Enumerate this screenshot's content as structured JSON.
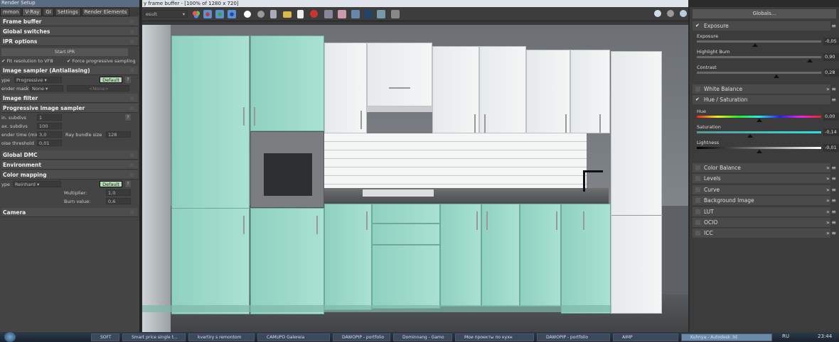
{
  "left_panel": {
    "title": "Render Setup",
    "tabs": [
      "mmon",
      "V-Ray",
      "GI",
      "Settings",
      "Render Elements"
    ],
    "active_tab": "V-Ray",
    "sections": {
      "frame_buffer": "Frame buffer",
      "global_switches": "Global switches",
      "ipr": "IPR options",
      "image_sampler": "Image sampler (Antialiasing)",
      "image_filter": "Image filter",
      "progressive": "Progressive image sampler",
      "global_dmc": "Global DMC",
      "environment": "Environment",
      "color_mapping": "Color mapping",
      "camera": "Camera"
    },
    "ipr": {
      "start_label": "Start IPR",
      "fit_label": "Fit resolution to VFB",
      "force_label": "Force progressive sampling"
    },
    "sampler": {
      "type_label": "ype",
      "type_value": "Progressive",
      "default_label": "Default",
      "help": "?",
      "mask_label": "ender mask",
      "mask_value": "None",
      "mask_none": "<None>"
    },
    "progressive": {
      "min_label": "in. subdivs",
      "min_value": "1",
      "max_label": "ax. subdivs",
      "max_value": "100",
      "time_label": "ender time (min)",
      "time_value": "3,0",
      "bundle_label": "Ray bundle size",
      "bundle_value": "128",
      "noise_label": "oise threshold",
      "noise_value": "0,01",
      "help": "?"
    },
    "color_mapping": {
      "type_label": "ype",
      "type_value": "Reinhard",
      "default_label": "Default",
      "help": "?",
      "mult_label": "Multiplier:",
      "mult_value": "1,0",
      "burn_label": "Burn value:",
      "burn_value": "0,6"
    }
  },
  "viewport": {
    "title": "y frame buffer - [100% of 1280 x 720]",
    "channel": "esult"
  },
  "right_panel": {
    "globals_label": "Globals...",
    "exposure": {
      "title": "Exposure",
      "sliders": [
        {
          "label": "Exposure",
          "value": "-0,05",
          "pos": 0.47
        },
        {
          "label": "Highlight Burn",
          "value": "0,90",
          "pos": 0.91
        },
        {
          "label": "Contrast",
          "value": "0,28",
          "pos": 0.64
        }
      ]
    },
    "white_balance": "White Balance",
    "hue_sat": {
      "title": "Hue / Saturation",
      "sliders": [
        {
          "label": "Hue",
          "value": "0,00",
          "pos": 0.5
        },
        {
          "label": "Saturation",
          "value": "-0,14",
          "pos": 0.43
        },
        {
          "label": "Lightness",
          "value": "-0,01",
          "pos": 0.5
        }
      ]
    },
    "collapsed": [
      "Color Balance",
      "Levels",
      "Curve",
      "Background Image",
      "LUT",
      "OCIO",
      "ICC"
    ]
  },
  "taskbar": {
    "items": [
      "SOFT",
      "Smart price single t...",
      "kvartiry s remontom",
      "CAMUPO Galereia",
      "DAWOPIP - portfolio",
      "Dominnang - Gamo",
      "Мои проекты по кухн",
      "DAWOPIP - portfolio",
      "AIMP",
      "Kuhnya - Autodesk 3d"
    ],
    "lang": "RU",
    "clock": "23:44"
  }
}
